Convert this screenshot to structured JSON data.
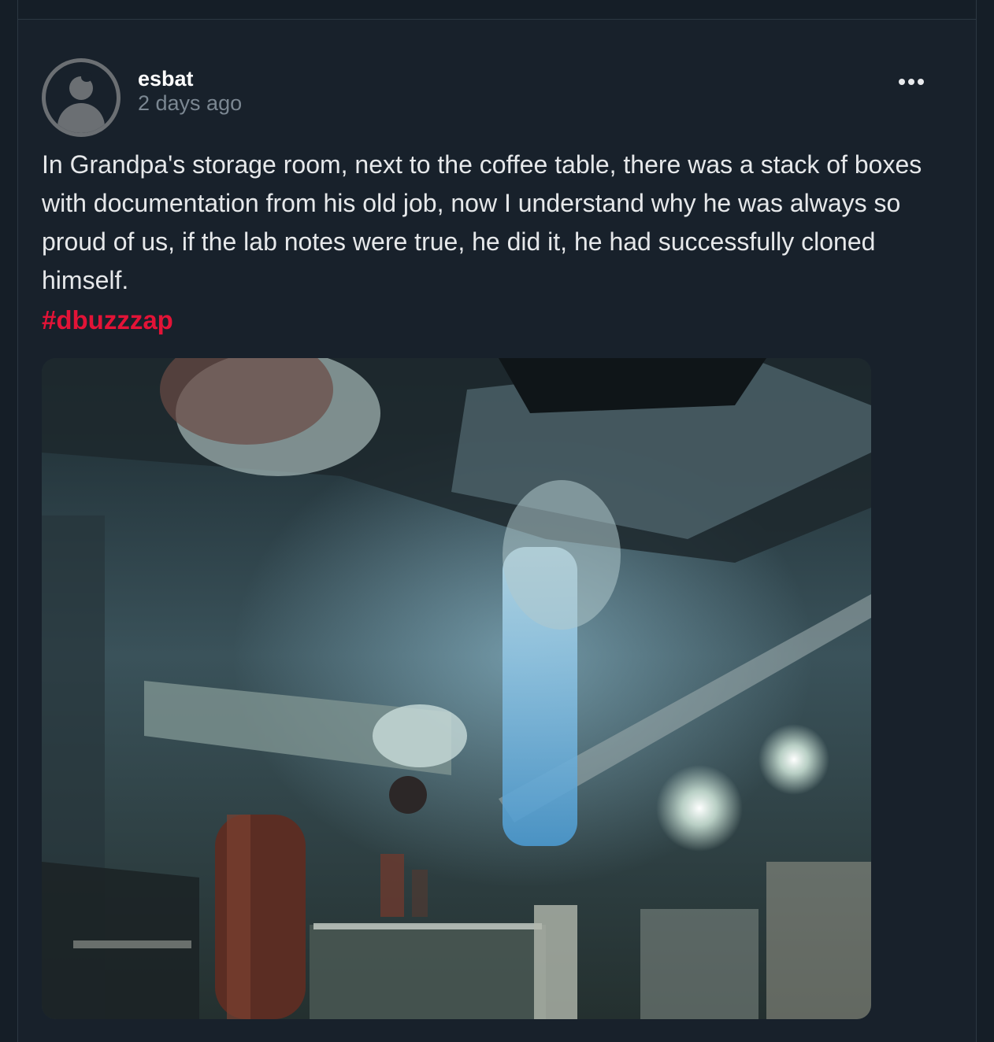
{
  "post": {
    "author": "esbat",
    "time_ago": "2 days ago",
    "body": "In Grandpa's storage room, next to the coffee table, there was a stack of boxes with documentation from his old job, now I understand why he was always so proud of us, if the lab notes were true, he did it, he had successfully cloned himself.",
    "hashtag": "#dbuzzzap",
    "image_subject": "dark laboratory with ceiling pipes and glowing tube"
  },
  "icons": {
    "avatar": "user-avatar-icon",
    "more": "more-options-icon"
  },
  "colors": {
    "background": "#151e27",
    "card": "#18212b",
    "hashtag": "#e31337",
    "muted_text": "#7b8792"
  }
}
